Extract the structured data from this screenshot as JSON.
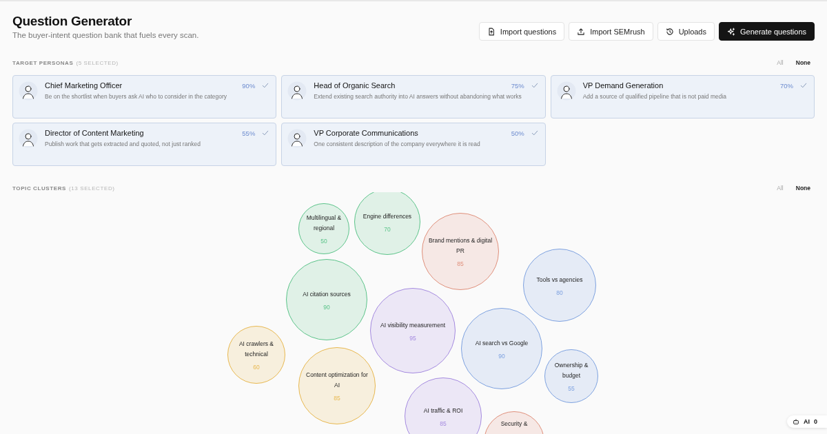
{
  "header": {
    "title": "Question Generator",
    "subtitle": "The buyer-intent question bank that fuels every scan."
  },
  "actions": [
    {
      "kind": "import",
      "label": "Import questions",
      "primary": false
    },
    {
      "kind": "upload",
      "label": "Import SEMrush",
      "primary": false
    },
    {
      "kind": "history",
      "label": "Uploads",
      "primary": false
    },
    {
      "kind": "sparkle",
      "label": "Generate questions",
      "primary": true
    }
  ],
  "personas": {
    "heading": "TARGET PERSONAS",
    "count": "(5 SELECTED)",
    "all": {
      "label": "All",
      "disabled": true
    },
    "none": {
      "label": "None",
      "disabled": false
    },
    "items": [
      {
        "name": "Chief Marketing Officer",
        "description": "Be on the shortlist when buyers ask AI who to consider in the category",
        "percent": "90%",
        "selected": true
      },
      {
        "name": "Head of Organic Search",
        "description": "Extend existing search authority into AI answers without abandoning what works",
        "percent": "75%",
        "selected": true
      },
      {
        "name": "VP Demand Generation",
        "description": "Add a source of qualified pipeline that is not paid media",
        "percent": "70%",
        "selected": true
      },
      {
        "name": "Director of Content Marketing",
        "description": "Publish work that gets extracted and quoted, not just ranked",
        "percent": "55%",
        "selected": true
      },
      {
        "name": "VP Corporate Communications",
        "description": "One consistent description of the company everywhere it is read",
        "percent": "50%",
        "selected": true
      }
    ]
  },
  "topics": {
    "heading": "TOPIC CLUSTERS",
    "count": "(13 SELECTED)",
    "all": {
      "label": "All",
      "disabled": true
    },
    "none": {
      "label": "None",
      "disabled": false
    },
    "clusters": [
      {
        "label": "Multilingual & regional",
        "score": "50",
        "color": "#5cc48a"
      },
      {
        "label": "Engine differences",
        "score": "70",
        "color": "#5cc48a"
      },
      {
        "label": "Brand mentions & digital PR",
        "score": "85",
        "color": "#e0907c"
      },
      {
        "label": "Tools vs agencies",
        "score": "80",
        "color": "#7ea2e0"
      },
      {
        "label": "AI citation sources",
        "score": "90",
        "color": "#5cc48a"
      },
      {
        "label": "AI visibility measurement",
        "score": "95",
        "color": "#a58be0"
      },
      {
        "label": "AI crawlers & technical",
        "score": "60",
        "color": "#e8b850"
      },
      {
        "label": "AI search vs Google",
        "score": "90",
        "color": "#7ea2e0"
      },
      {
        "label": "Ownership & budget",
        "score": "55",
        "color": "#7ea2e0"
      },
      {
        "label": "Content optimization for AI",
        "score": "85",
        "color": "#e8b850"
      },
      {
        "label": "AI traffic & ROI",
        "score": "85",
        "color": "#a58be0"
      },
      {
        "label": "Security &",
        "color": "#e0907c"
      }
    ]
  },
  "ai_badge": {
    "label": "AI",
    "count": "0"
  }
}
